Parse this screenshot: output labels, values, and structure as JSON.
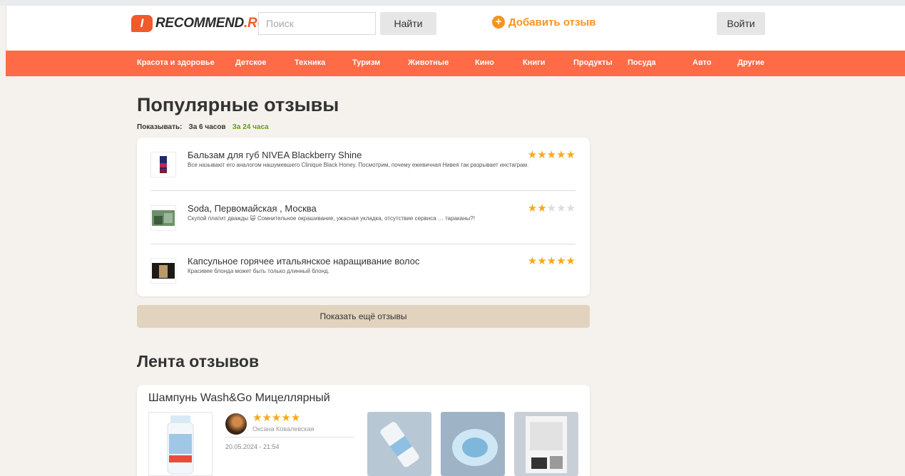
{
  "header": {
    "logo_mark": "I",
    "logo_text": "RECOMMEND",
    "logo_suffix": ".RU",
    "search_placeholder": "Поиск",
    "find_label": "Найти",
    "add_review_label": "Добавить отзыв",
    "login_label": "Войти"
  },
  "nav": {
    "items": [
      "Красота и здоровье",
      "Детское",
      "Техника",
      "Туризм",
      "Животные",
      "Кино",
      "Книги",
      "Продукты",
      "Посуда",
      "Авто",
      "Другие"
    ]
  },
  "popular": {
    "title": "Популярные отзывы",
    "show_label": "Показывать:",
    "options": [
      "За 6 часов",
      "За 24 часа"
    ],
    "active_option": "За 24 часа",
    "reviews": [
      {
        "title": "Бальзам для губ NIVEA Blackberry Shine",
        "desc": "Все называют его аналогом нашумевшего Clinique Black Honey. Посмотрим, почему ежевичная Нивея так разрывает инстаграм.",
        "rating": 5
      },
      {
        "title": "Soda, Первомайская , Москва",
        "desc": "Скупой платит дважды 🙀 Сомнительное окрашивание, ужасная укладка, отсутствие сервиса … тараканы?!",
        "rating": 2
      },
      {
        "title": "Капсульное горячее итальянское наращивание волос",
        "desc": "Красивее блонда может быть только длинный блонд.",
        "rating": 5
      }
    ],
    "more_label": "Показать ещё отзывы"
  },
  "feed": {
    "title": "Лента отзывов",
    "card": {
      "title": "Шампунь Wash&Go Мицеллярный",
      "rating": 5,
      "author": "Оксана Ковалевская",
      "date": "20.05.2024 - 21:54"
    }
  },
  "colors": {
    "accent": "#ff6a47",
    "brand": "#f15a29",
    "star": "#f7a91a",
    "active_filter": "#6a9a10",
    "more_button": "#e2d3be"
  }
}
